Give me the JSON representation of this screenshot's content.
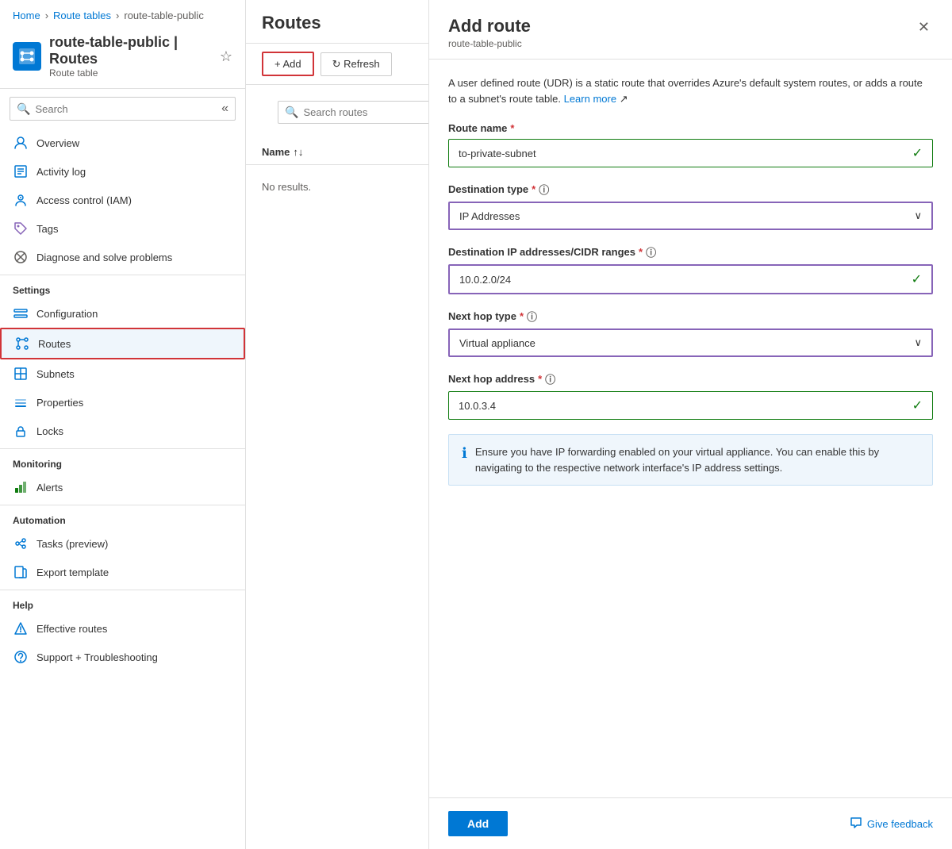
{
  "breadcrumb": {
    "home": "Home",
    "route_tables": "Route tables",
    "resource": "route-table-public"
  },
  "resource": {
    "name": "route-table-public | Routes",
    "type": "Route table",
    "icon": "🗺"
  },
  "sidebar": {
    "search_placeholder": "Search",
    "nav_items": [
      {
        "id": "overview",
        "label": "Overview",
        "icon": "overview"
      },
      {
        "id": "activity-log",
        "label": "Activity log",
        "icon": "activity"
      },
      {
        "id": "access-control",
        "label": "Access control (IAM)",
        "icon": "iam"
      },
      {
        "id": "tags",
        "label": "Tags",
        "icon": "tags"
      },
      {
        "id": "diagnose",
        "label": "Diagnose and solve problems",
        "icon": "diagnose"
      }
    ],
    "settings_label": "Settings",
    "settings_items": [
      {
        "id": "configuration",
        "label": "Configuration",
        "icon": "config"
      },
      {
        "id": "routes",
        "label": "Routes",
        "icon": "routes",
        "active": true
      },
      {
        "id": "subnets",
        "label": "Subnets",
        "icon": "subnets"
      },
      {
        "id": "properties",
        "label": "Properties",
        "icon": "properties"
      },
      {
        "id": "locks",
        "label": "Locks",
        "icon": "locks"
      }
    ],
    "monitoring_label": "Monitoring",
    "monitoring_items": [
      {
        "id": "alerts",
        "label": "Alerts",
        "icon": "alerts"
      }
    ],
    "automation_label": "Automation",
    "automation_items": [
      {
        "id": "tasks",
        "label": "Tasks (preview)",
        "icon": "tasks"
      },
      {
        "id": "export",
        "label": "Export template",
        "icon": "export"
      }
    ],
    "help_label": "Help",
    "help_items": [
      {
        "id": "effective-routes",
        "label": "Effective routes",
        "icon": "effective"
      },
      {
        "id": "support",
        "label": "Support + Troubleshooting",
        "icon": "support"
      }
    ]
  },
  "main": {
    "title": "Routes",
    "add_label": "+ Add",
    "refresh_label": "↻ Refresh",
    "search_routes_placeholder": "Search routes",
    "table_column": "Name",
    "no_results": "No results."
  },
  "panel": {
    "title": "Add route",
    "subtitle": "route-table-public",
    "description": "A user defined route (UDR) is a static route that overrides Azure's default system routes, or adds a route to a subnet's route table.",
    "learn_more": "Learn more",
    "route_name_label": "Route name",
    "route_name_required": "*",
    "route_name_value": "to-private-subnet",
    "dest_type_label": "Destination type",
    "dest_type_required": "*",
    "dest_type_value": "IP Addresses",
    "dest_ip_label": "Destination IP addresses/CIDR ranges",
    "dest_ip_required": "*",
    "dest_ip_value": "10.0.2.0/24",
    "next_hop_type_label": "Next hop type",
    "next_hop_type_required": "*",
    "next_hop_type_value": "Virtual appliance",
    "next_hop_addr_label": "Next hop address",
    "next_hop_addr_required": "*",
    "next_hop_addr_value": "10.0.3.4",
    "info_message": "Ensure you have IP forwarding enabled on your virtual appliance. You can enable this by navigating to the respective network interface's IP address settings.",
    "add_button": "Add",
    "feedback_label": "Give feedback"
  }
}
